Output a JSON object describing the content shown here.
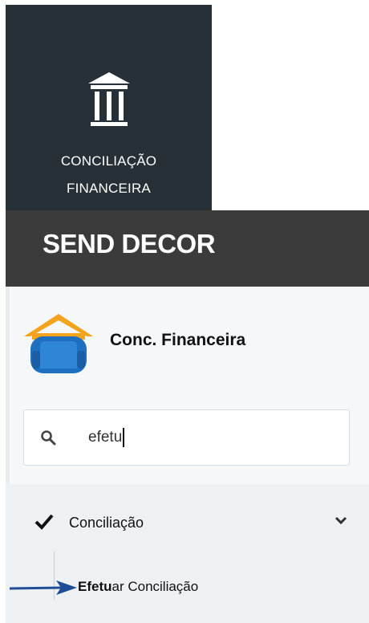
{
  "module_tile": {
    "icon": "bank-icon",
    "label_line1": "CONCILIAÇÃO",
    "label_line2": "FINANCEIRA"
  },
  "brand": {
    "name": "SEND DECOR"
  },
  "app": {
    "logo_icon": "armchair-house-logo",
    "title": "Conc. Financeira"
  },
  "search": {
    "icon": "search-icon",
    "value": "efetu"
  },
  "menu": {
    "item_label": "Conciliação",
    "item_icon": "check-icon",
    "expand_icon": "chevron-down-icon",
    "sub_item_bold": "Efetu",
    "sub_item_rest": "ar Conciliação"
  },
  "annotation": {
    "icon": "arrow-right-icon",
    "color": "#1f4e96"
  },
  "colors": {
    "tile_bg": "#263036",
    "brand_bg": "#3b3b3b",
    "logo_orange": "#f3a31c",
    "logo_blue": "#1f6fc0"
  }
}
